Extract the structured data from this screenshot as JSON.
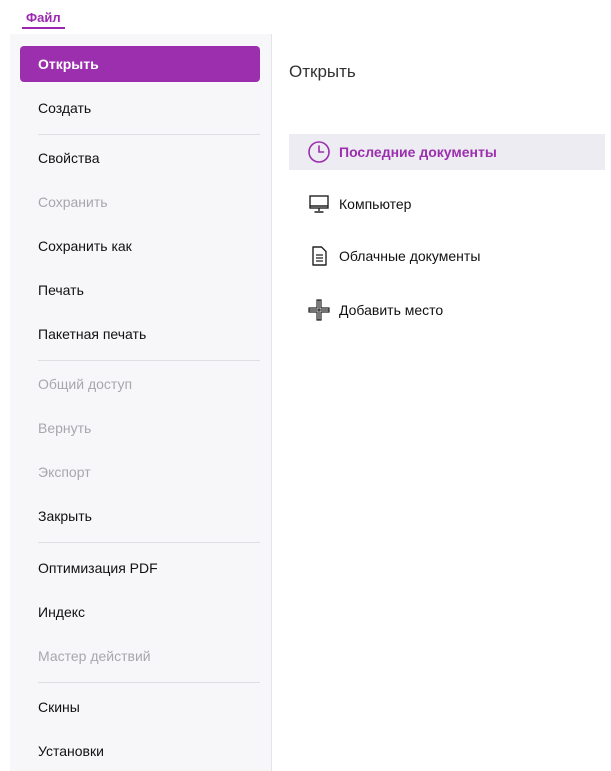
{
  "menu": {
    "file_tab": "Файл"
  },
  "sidebar": {
    "items": [
      {
        "label": "Открыть",
        "state": "active"
      },
      {
        "label": "Создать",
        "state": "normal"
      },
      {
        "label": "Свойства",
        "state": "normal"
      },
      {
        "label": "Сохранить",
        "state": "disabled"
      },
      {
        "label": "Сохранить как",
        "state": "normal"
      },
      {
        "label": "Печать",
        "state": "normal"
      },
      {
        "label": "Пакетная печать",
        "state": "normal"
      },
      {
        "label": "Общий доступ",
        "state": "disabled"
      },
      {
        "label": "Вернуть",
        "state": "disabled"
      },
      {
        "label": "Экспорт",
        "state": "disabled"
      },
      {
        "label": "Закрыть",
        "state": "normal"
      },
      {
        "label": "Оптимизация PDF",
        "state": "normal"
      },
      {
        "label": "Индекс",
        "state": "normal"
      },
      {
        "label": "Мастер действий",
        "state": "disabled"
      },
      {
        "label": "Скины",
        "state": "normal"
      },
      {
        "label": "Установки",
        "state": "normal"
      }
    ]
  },
  "content": {
    "title": "Открыть",
    "locations": [
      {
        "label": "Последние документы",
        "icon": "clock-icon",
        "selected": true
      },
      {
        "label": "Компьютер",
        "icon": "monitor-icon",
        "selected": false
      },
      {
        "label": "Облачные документы",
        "icon": "document-icon",
        "selected": false
      },
      {
        "label": "Добавить место",
        "icon": "plus-icon",
        "selected": false
      }
    ]
  },
  "colors": {
    "accent": "#9b2fae",
    "sidebar_bg": "#f7f7f9",
    "disabled_text": "#a7a7ad",
    "selected_bg": "#ececf2"
  }
}
